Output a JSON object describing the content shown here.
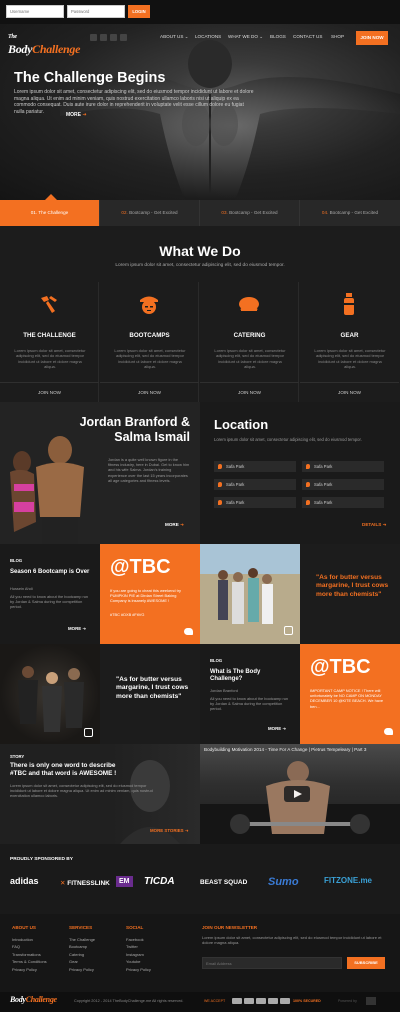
{
  "topbar": {
    "username_placeholder": "Username",
    "password_placeholder": "Password",
    "login_label": "LOGIN"
  },
  "brand": {
    "logo_prefix": "The",
    "logo_main": "Body",
    "logo_accent": "Challenge",
    "accent_color": "#f37021"
  },
  "nav": {
    "items": [
      "ABOUT US ⌄",
      "LOCATIONS",
      "WHAT WE DO ⌄",
      "BLOGS",
      "CONTACT US",
      "SHOP"
    ],
    "join_label": "JOIN NOW"
  },
  "hero": {
    "title": "The Challenge Begins",
    "text": "Lorem ipsum dolor sit amet, consectetur adipiscing elit, sed do eiusmod tempor incididunt ut labore et dolore magna aliqua. Ut enim ad minim veniam, quis nostrud exercitation ullamco laboris nisi ut aliquip ex ea commodo consequat. Duis aute irure dolor in reprehenderit in voluptate velit esse cillum dolore eu fugiat nulla pariatur.",
    "more_label": "MORE"
  },
  "tabs": [
    {
      "num": "01.",
      "label": "The Challenge"
    },
    {
      "num": "02.",
      "label": "Bootcamp - Get Excited"
    },
    {
      "num": "03.",
      "label": "Bootcamp - Get Excited"
    },
    {
      "num": "04.",
      "label": "Bootcamp - Get Excited"
    }
  ],
  "what_we_do": {
    "title": "What We Do",
    "subtitle": "Lorem ipsum dolor sit amet, consectetur adipiscing elit, sed do eiusmod tempor.",
    "services": [
      {
        "title": "THE CHALLENGE",
        "icon": "grip-trainer-icon",
        "text": "Lorem ipsum dolor sit amet, consectetur adipiscing elit, sed do eiusmod tempor incididunt ut labore et dolore magna aliqua.",
        "join": "JOIN NOW"
      },
      {
        "title": "BOOTCAMPS",
        "icon": "drill-sergeant-icon",
        "text": "Lorem ipsum dolor sit amet, consectetur adipiscing elit, sed do eiusmod tempor incididunt ut labore et dolore magna aliqua.",
        "join": "JOIN NOW"
      },
      {
        "title": "CATERING",
        "icon": "chicken-leg-icon",
        "text": "Lorem ipsum dolor sit amet, consectetur adipiscing elit, sed do eiusmod tempor incididunt ut labore et dolore magna aliqua.",
        "join": "JOIN NOW"
      },
      {
        "title": "GEAR",
        "icon": "water-bottle-icon",
        "text": "Lorem ipsum dolor sit amet, consectetur adipiscing elit, sed do eiusmod tempor incididunt ut labore et dolore magna aliqua.",
        "join": "JOIN NOW"
      }
    ]
  },
  "jordan": {
    "title_line1": "Jordan Branford &",
    "title_line2": "Salma Ismail",
    "text": "Jordan is a quite well known figure in the fitness industry, here in Dubai. Get to know him and his wife Salma. Jordan's training experience over the last 15 years incorporates all age categories and fitness levels.",
    "more_label": "MORE"
  },
  "location": {
    "title": "Location",
    "subtitle": "Lorem ipsum dolor sit amet, consectetur adipiscing elit, sed do eiusmod tempor.",
    "items": [
      "Safa Park",
      "Safa Park",
      "Safa Park",
      "Safa Park",
      "Safa Park",
      "Safa Park"
    ],
    "details_label": "DETAILS"
  },
  "blog1": {
    "tag": "BLOG",
    "title": "Season 6 Bootcamp is Over",
    "author": "Hussein Ahdi",
    "text": "All you need to know about the bootcamp run by Jordan & Salma during the competition period.",
    "more_label": "MORE"
  },
  "tbc1": {
    "handle": "@TBC",
    "text": "If you are going to cheat this weekend try PUMPKIN PIE at Dirdan Street Baking Company is insanely AWESOME !",
    "links": "#TBC  #DXB  #FitVG"
  },
  "quote1": {
    "text": "\"As for butter versus margarine, I trust cows more than chemists\""
  },
  "quote2": {
    "text": "\"As for butter versus margarine, I trust cows more than chemists\""
  },
  "blog2": {
    "tag": "BLOG",
    "title": "What is The Body Challenge?",
    "author": "Jordan Branford",
    "text": "All you need to know about the bootcamp run by Jordan & Salma during the competition period.",
    "more_label": "MORE"
  },
  "tbc2": {
    "handle": "@TBC",
    "text": "IMPORTANT CAMP NOTICE ! There will unfortunately be NO CAMP ON MONDAY DECEMBER 10 @KITE BEACH. We have ben..."
  },
  "story": {
    "tag": "STORY",
    "title": "There is only one word to describe #TBC and that word is AWESOME !",
    "text": "Lorem ipsum dolor sit amet, consectetur adipiscing elit, sed do eiusmod tempor incididunt ut labore et dolore magna aliqua. Ut enim ad minim veniam, quis nostrud exercitation ullamco laboris.",
    "more_label": "MORE STORIES"
  },
  "video": {
    "title": "Bodybuilding Motivation 2014 - Time For A Change | Pietrus Tempeleary | Part 3"
  },
  "sponsors": {
    "title": "PROUDLY SPONSORED BY",
    "logos": [
      "adidas",
      "FITNESSLINK",
      "EM",
      "TICDA",
      "BEAST SQUAD",
      "Sumo",
      "FITZONE.me"
    ]
  },
  "footer": {
    "col1": {
      "title": "ABOUT US",
      "links": [
        "Introduction",
        "FAQ",
        "Transformations",
        "Terms & Conditions",
        "Privacy Policy"
      ]
    },
    "col2": {
      "title": "SERVICES",
      "links": [
        "The Challenge",
        "Bootcamp",
        "Catering",
        "Gear",
        "Privacy Policy"
      ]
    },
    "col3": {
      "title": "SOCIAL",
      "links": [
        "Facebook",
        "Twitter",
        "Instagram",
        "Youtube",
        "Privacy Policy"
      ]
    },
    "newsletter": {
      "title": "JOIN OUR NEWSLETTER",
      "text": "Lorem ipsum dolor sit amet, consectetur adipiscing elit, sed do eiusmod tempor incididunt ut labore et dolore magna aliqua.",
      "placeholder": "Email Address",
      "button": "SUBSCRIBE"
    }
  },
  "bottombar": {
    "copyright": "Copyright 2012 - 2014 TheBodyChallenge.me All rights reserved.",
    "we_accept": "WE ACCEPT",
    "secured": "100% SECURED",
    "powered": "Powered by"
  }
}
